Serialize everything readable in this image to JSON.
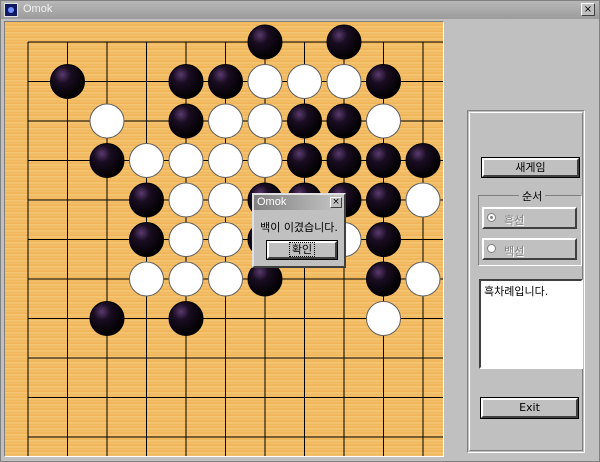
{
  "window": {
    "title": "Omok",
    "close_glyph": "×"
  },
  "board": {
    "size": 15,
    "background_color": "#f2c172",
    "line_color": "#000000",
    "stones": [
      {
        "col": 6,
        "row": 0,
        "color": "black"
      },
      {
        "col": 8,
        "row": 0,
        "color": "black"
      },
      {
        "col": 1,
        "row": 1,
        "color": "black"
      },
      {
        "col": 4,
        "row": 1,
        "color": "black"
      },
      {
        "col": 5,
        "row": 1,
        "color": "black"
      },
      {
        "col": 6,
        "row": 1,
        "color": "white"
      },
      {
        "col": 7,
        "row": 1,
        "color": "white"
      },
      {
        "col": 8,
        "row": 1,
        "color": "white"
      },
      {
        "col": 9,
        "row": 1,
        "color": "black"
      },
      {
        "col": 2,
        "row": 2,
        "color": "white"
      },
      {
        "col": 4,
        "row": 2,
        "color": "black"
      },
      {
        "col": 5,
        "row": 2,
        "color": "white"
      },
      {
        "col": 6,
        "row": 2,
        "color": "white"
      },
      {
        "col": 7,
        "row": 2,
        "color": "black"
      },
      {
        "col": 8,
        "row": 2,
        "color": "black"
      },
      {
        "col": 9,
        "row": 2,
        "color": "white"
      },
      {
        "col": 2,
        "row": 3,
        "color": "black"
      },
      {
        "col": 3,
        "row": 3,
        "color": "white"
      },
      {
        "col": 4,
        "row": 3,
        "color": "white"
      },
      {
        "col": 5,
        "row": 3,
        "color": "white"
      },
      {
        "col": 6,
        "row": 3,
        "color": "white"
      },
      {
        "col": 7,
        "row": 3,
        "color": "black"
      },
      {
        "col": 8,
        "row": 3,
        "color": "black"
      },
      {
        "col": 9,
        "row": 3,
        "color": "black"
      },
      {
        "col": 10,
        "row": 3,
        "color": "black"
      },
      {
        "col": 3,
        "row": 4,
        "color": "black"
      },
      {
        "col": 4,
        "row": 4,
        "color": "white"
      },
      {
        "col": 5,
        "row": 4,
        "color": "white"
      },
      {
        "col": 6,
        "row": 4,
        "color": "black"
      },
      {
        "col": 7,
        "row": 4,
        "color": "black"
      },
      {
        "col": 8,
        "row": 4,
        "color": "black"
      },
      {
        "col": 9,
        "row": 4,
        "color": "black"
      },
      {
        "col": 10,
        "row": 4,
        "color": "white"
      },
      {
        "col": 3,
        "row": 5,
        "color": "black"
      },
      {
        "col": 4,
        "row": 5,
        "color": "white"
      },
      {
        "col": 5,
        "row": 5,
        "color": "white"
      },
      {
        "col": 6,
        "row": 5,
        "color": "black"
      },
      {
        "col": 8,
        "row": 5,
        "color": "white"
      },
      {
        "col": 9,
        "row": 5,
        "color": "black"
      },
      {
        "col": 3,
        "row": 6,
        "color": "white"
      },
      {
        "col": 4,
        "row": 6,
        "color": "white"
      },
      {
        "col": 5,
        "row": 6,
        "color": "white"
      },
      {
        "col": 6,
        "row": 6,
        "color": "black"
      },
      {
        "col": 9,
        "row": 6,
        "color": "black"
      },
      {
        "col": 10,
        "row": 6,
        "color": "white"
      },
      {
        "col": 2,
        "row": 7,
        "color": "black"
      },
      {
        "col": 4,
        "row": 7,
        "color": "black"
      },
      {
        "col": 9,
        "row": 7,
        "color": "white"
      }
    ]
  },
  "controls": {
    "new_game_label": "새게임",
    "order_group_label": "순서",
    "radio_black_label": "흑선",
    "radio_white_label": "백선",
    "radio_black_checked": true,
    "status_text": "흑차례입니다.",
    "exit_label": "Exit"
  },
  "dialog": {
    "title": "Omok",
    "close_glyph": "×",
    "message": "백이 이겼습니다.",
    "ok_label": "확인"
  }
}
